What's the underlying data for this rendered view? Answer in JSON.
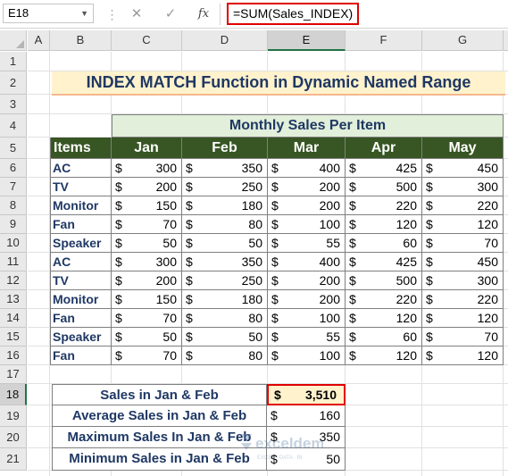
{
  "formula_bar": {
    "name_box": "E18",
    "cancel_glyph": "✕",
    "enter_glyph": "✓",
    "fx_label": "fx",
    "formula": "=SUM(Sales_INDEX)"
  },
  "columns": [
    "A",
    "B",
    "C",
    "D",
    "E",
    "F",
    "G"
  ],
  "selected_column": "E",
  "rows": [
    "1",
    "2",
    "3",
    "4",
    "5",
    "6",
    "7",
    "8",
    "9",
    "10",
    "11",
    "12",
    "13",
    "14",
    "15",
    "16",
    "17",
    "18",
    "19",
    "20",
    "21"
  ],
  "selected_row": "18",
  "title": "INDEX MATCH Function in Dynamic Named Range",
  "table": {
    "subtitle": "Monthly Sales Per Item",
    "headers": [
      "Items",
      "Jan",
      "Feb",
      "Mar",
      "Apr",
      "May"
    ],
    "currency": "$",
    "rows": [
      {
        "item": "AC",
        "values": [
          "300",
          "350",
          "400",
          "425",
          "450"
        ]
      },
      {
        "item": "TV",
        "values": [
          "200",
          "250",
          "200",
          "500",
          "300"
        ]
      },
      {
        "item": "Monitor",
        "values": [
          "150",
          "180",
          "200",
          "220",
          "220"
        ]
      },
      {
        "item": "Fan",
        "values": [
          "70",
          "80",
          "100",
          "120",
          "120"
        ]
      },
      {
        "item": "Speaker",
        "values": [
          "50",
          "50",
          "55",
          "60",
          "70"
        ]
      },
      {
        "item": "AC",
        "values": [
          "300",
          "350",
          "400",
          "425",
          "450"
        ]
      },
      {
        "item": "TV",
        "values": [
          "200",
          "250",
          "200",
          "500",
          "300"
        ]
      },
      {
        "item": "Monitor",
        "values": [
          "150",
          "180",
          "200",
          "220",
          "220"
        ]
      },
      {
        "item": "Fan",
        "values": [
          "70",
          "80",
          "100",
          "120",
          "120"
        ]
      },
      {
        "item": "Speaker",
        "values": [
          "50",
          "50",
          "55",
          "60",
          "70"
        ]
      },
      {
        "item": "Fan",
        "values": [
          "70",
          "80",
          "100",
          "120",
          "120"
        ]
      }
    ]
  },
  "summary": [
    {
      "label": "Sales in Jan & Feb",
      "value": "3,510"
    },
    {
      "label": "Average Sales in Jan & Feb",
      "value": "160"
    },
    {
      "label": "Maximum Sales In Jan & Feb",
      "value": "350"
    },
    {
      "label": "Minimum Sales in Jan & Feb",
      "value": "50"
    }
  ],
  "watermark": {
    "name": "exceldemy",
    "tagline": "EXCEL · DATA · BI"
  },
  "colors": {
    "header_green": "#375623",
    "subtitle_green": "#e2efda",
    "title_fill": "#fff2cc",
    "label_blue": "#1f3864",
    "highlight_red": "#e00000",
    "excel_green": "#217346"
  }
}
